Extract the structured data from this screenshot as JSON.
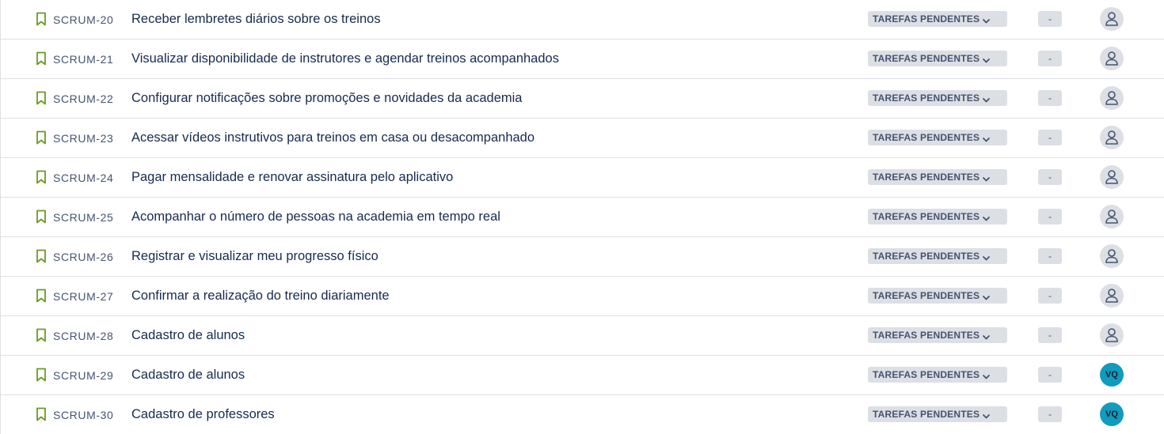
{
  "colors": {
    "issue_icon": "#6a9a23",
    "lozenge_bg": "#dcdfe4",
    "avatar_user_bg": "#0f9cbe",
    "avatar_unassigned_bg": "#dcdfe4",
    "divider": "#dfe1e6"
  },
  "icons": {
    "issue_type": "bookmark-icon",
    "status_dropdown": "chevron-down-icon",
    "unassigned": "person-icon"
  },
  "issues": [
    {
      "key": "SCRUM-20",
      "summary": "Receber lembretes diários sobre os treinos",
      "status": "TAREFAS PENDENTES",
      "points": "-",
      "assignee_initials": ""
    },
    {
      "key": "SCRUM-21",
      "summary": "Visualizar disponibilidade de instrutores e agendar treinos acompanhados",
      "status": "TAREFAS PENDENTES",
      "points": "-",
      "assignee_initials": ""
    },
    {
      "key": "SCRUM-22",
      "summary": "Configurar notificações sobre promoções e novidades da academia",
      "status": "TAREFAS PENDENTES",
      "points": "-",
      "assignee_initials": ""
    },
    {
      "key": "SCRUM-23",
      "summary": "Acessar vídeos instrutivos para treinos em casa ou desacompanhado",
      "status": "TAREFAS PENDENTES",
      "points": "-",
      "assignee_initials": ""
    },
    {
      "key": "SCRUM-24",
      "summary": "Pagar mensalidade e renovar assinatura pelo aplicativo",
      "status": "TAREFAS PENDENTES",
      "points": "-",
      "assignee_initials": ""
    },
    {
      "key": "SCRUM-25",
      "summary": "Acompanhar o número de pessoas na academia em tempo real",
      "status": "TAREFAS PENDENTES",
      "points": "-",
      "assignee_initials": ""
    },
    {
      "key": "SCRUM-26",
      "summary": "Registrar e visualizar meu progresso físico",
      "status": "TAREFAS PENDENTES",
      "points": "-",
      "assignee_initials": ""
    },
    {
      "key": "SCRUM-27",
      "summary": "Confirmar a realização do treino diariamente",
      "status": "TAREFAS PENDENTES",
      "points": "-",
      "assignee_initials": ""
    },
    {
      "key": "SCRUM-28",
      "summary": "Cadastro de alunos",
      "status": "TAREFAS PENDENTES",
      "points": "-",
      "assignee_initials": ""
    },
    {
      "key": "SCRUM-29",
      "summary": "Cadastro de alunos",
      "status": "TAREFAS PENDENTES",
      "points": "-",
      "assignee_initials": "VQ"
    },
    {
      "key": "SCRUM-30",
      "summary": "Cadastro de professores",
      "status": "TAREFAS PENDENTES",
      "points": "-",
      "assignee_initials": "VQ"
    }
  ]
}
